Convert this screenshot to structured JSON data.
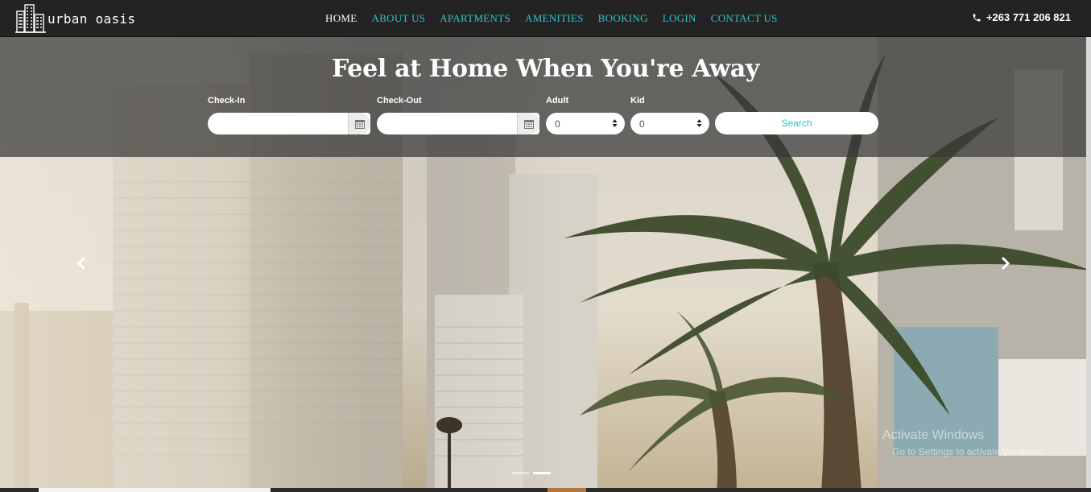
{
  "brand": {
    "name": "urban oasis",
    "logo_icon": "city-buildings-icon"
  },
  "nav": {
    "items": [
      {
        "label": "HOME",
        "active": true
      },
      {
        "label": "ABOUT US",
        "active": false
      },
      {
        "label": "APARTMENTS",
        "active": false
      },
      {
        "label": "AMENITIES",
        "active": false
      },
      {
        "label": "BOOKING",
        "active": false
      },
      {
        "label": "LOGIN",
        "active": false
      },
      {
        "label": "CONTACT US",
        "active": false
      }
    ],
    "phone": "+263 771 206 821",
    "phone_icon": "phone-icon"
  },
  "hero": {
    "title": "Feel at Home When You're Away",
    "booking": {
      "checkin_label": "Check-In",
      "checkin_value": "",
      "checkout_label": "Check-Out",
      "checkout_value": "",
      "adult_label": "Adult",
      "adult_value": "0",
      "kid_label": "Kid",
      "kid_value": "0",
      "search_label": "Search",
      "calendar_icon": "calendar-icon"
    },
    "carousel": {
      "prev_icon": "chevron-left-icon",
      "next_icon": "chevron-right-icon",
      "slide_count": 2,
      "active_slide": 2
    }
  },
  "watermark": {
    "line1": "Activate Windows",
    "line2": "Go to Settings to activate Windows."
  },
  "colors": {
    "accent": "#2ec4cc",
    "navbar": "#232323",
    "band": "#373737"
  }
}
